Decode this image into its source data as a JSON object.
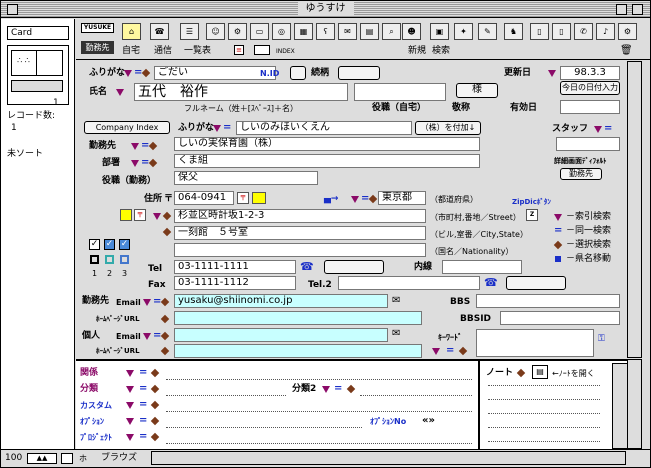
{
  "window": {
    "title": "ゆうすけ"
  },
  "sidebar": {
    "layout": "Card",
    "records_label": "レコード数:",
    "records_count": "1",
    "sort_status": "未ソート",
    "page_number": "1",
    "zoom": "100",
    "mode": "ブラウズ"
  },
  "toolbar": {
    "logo": "YUSUKE",
    "home_label": "自宅",
    "tsushin_label": "通信",
    "list_label": "一覧表",
    "new_label": "新規",
    "search_label": "検索",
    "kinmusaki_label": "勤務先",
    "index_label": "INDEX"
  },
  "form": {
    "furigana_label": "ふりがな",
    "furigana_value": "ごだい",
    "nid_label": "N.ID",
    "tsuzukigara_label": "続柄",
    "koshin_label": "更新日",
    "koshin_value": "98.3.3",
    "today_button": "今日の日付入力",
    "name_label": "氏名",
    "name_value": "五代　裕作",
    "sama_button": "様",
    "fullname_hint": "フルネーム（姓＋[ｽﾍﾟｰｽ]＋名）",
    "yakushoku_jitaku_label": "役職（自宅）",
    "keisho_label": "敬称",
    "yuko_label": "有効日",
    "company_index_button": "Company Index",
    "company_furigana_label": "ふりがな",
    "company_furigana_value": "しいのみほいくえん",
    "kabu_button": "（株）を付加↓",
    "staff_label": "スタッフ",
    "kinmusaki_label": "勤務先",
    "kinmusaki_value": "しいの実保育園（株）",
    "busho_label": "部署",
    "busho_value": "くま組",
    "shosai_label": "詳細画面ﾃﾞｨﾌｫﾙﾄ",
    "shosai_value": "勤務先",
    "yakushoku_kinmu_label": "役職（勤務）",
    "yakushoku_kinmu_value": "保父",
    "address_label": "住所",
    "postal_mark": "〒",
    "postal_value": "064-0941",
    "pref_value": "東京都",
    "pref_hint": "（都道府県）",
    "zip_label": "ZipDicﾎﾞﾀﾝ",
    "city_value": "杉並区時計坂1-2-3",
    "city_hint": "（市町村,番地／Street）",
    "bldg_value": "一刻館　５号室",
    "bldg_hint": "（ビル,室番／City,State）",
    "nation_hint": "（国名／Nationality）",
    "checks": [
      "1",
      "2",
      "3"
    ],
    "tel_label": "Tel",
    "tel_value": "03-1111-1111",
    "naisen_label": "内線",
    "fax_label": "Fax",
    "fax_value": "03-1111-1112",
    "tel2_label": "Tel.2",
    "kinmu_email_label": "勤務先",
    "email_label": "Email",
    "email_value": "yusaku@shiinomi.co.jp",
    "bbs_label": "BBS",
    "homepage_label": "ﾎｰﾑﾍﾟｰｼﾞURL",
    "bbsid_label": "BBSID",
    "kojin_label": "個人",
    "keyword_label": "ｷｰﾜｰﾄﾞ"
  },
  "legend": {
    "items": [
      "－索引検索",
      "－同一検索",
      "－選択検索",
      "－県名移動"
    ],
    "colors": {
      "tri": "#8b0a68",
      "eq": "#1a2fc8",
      "diamond": "#7a3a1a",
      "square": "#1a2fc8"
    }
  },
  "lower": {
    "kankei_label": "関係",
    "bunrui_label": "分類",
    "bunrui2_label": "分類2",
    "custom_label": "カスタム",
    "option_label": "ｵﾌﾟｼｮﾝ",
    "optionno_label": "ｵﾌﾟｼｮﾝNo",
    "optionno_arrows": "«»",
    "project_label": "ﾌﾟﾛｼﾞｪｸﾄ",
    "note_label": "ノート",
    "note_open": "←ﾉｰﾄを開く"
  }
}
